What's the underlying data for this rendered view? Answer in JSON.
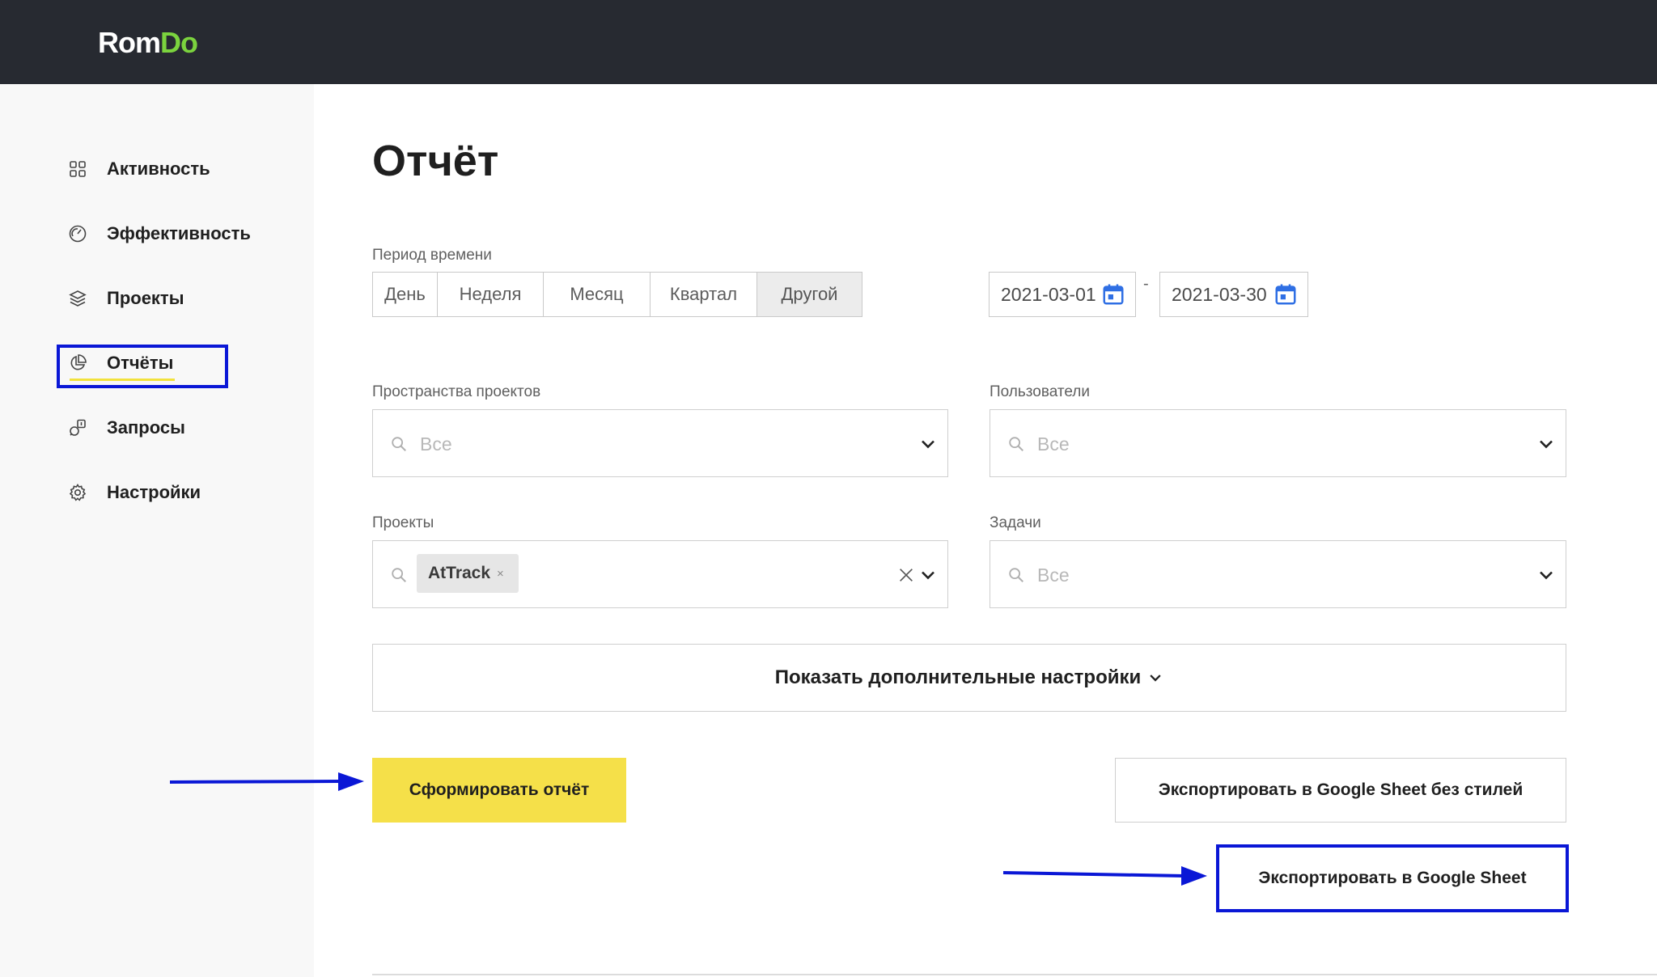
{
  "app": {
    "logo_main": "Rom",
    "logo_accent": "Do"
  },
  "sidebar": {
    "items": [
      {
        "label": "Активность",
        "icon": "grid-icon"
      },
      {
        "label": "Эффективность",
        "icon": "gauge-icon"
      },
      {
        "label": "Проекты",
        "icon": "layers-icon"
      },
      {
        "label": "Отчёты",
        "icon": "pie-chart-icon",
        "active": true
      },
      {
        "label": "Запросы",
        "icon": "requests-icon"
      },
      {
        "label": "Настройки",
        "icon": "gear-icon"
      }
    ]
  },
  "page": {
    "title": "Отчёт"
  },
  "period": {
    "label": "Период времени",
    "options": [
      "День",
      "Неделя",
      "Месяц",
      "Квартал",
      "Другой"
    ],
    "selected": "Другой",
    "date_from": "2021-03-01",
    "date_separator": "-",
    "date_to": "2021-03-30"
  },
  "filters": {
    "spaces": {
      "label": "Пространства проектов",
      "placeholder": "Все"
    },
    "users": {
      "label": "Пользователи",
      "placeholder": "Все"
    },
    "projects": {
      "label": "Проекты",
      "tag": "AtTrack",
      "tag_remove": "×"
    },
    "tasks": {
      "label": "Задачи",
      "placeholder": "Все"
    }
  },
  "actions": {
    "more_settings": "Показать дополнительные настройки",
    "generate": "Сформировать отчёт",
    "export_plain": "Экспортировать в Google Sheet без стилей",
    "export": "Экспортировать в Google Sheet"
  },
  "colors": {
    "topbar": "#272a31",
    "logo_accent": "#7bd33e",
    "primary_button": "#f5e049",
    "annotation_blue": "#0a17d6",
    "calendar_icon": "#2f6fe4"
  }
}
